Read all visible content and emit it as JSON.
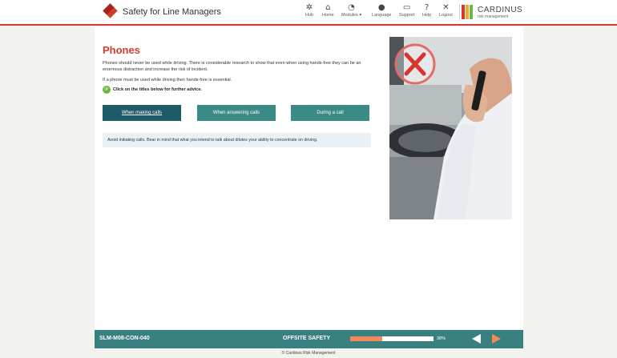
{
  "app": {
    "title": "Safety for Line Managers"
  },
  "nav": [
    {
      "label": "Hub",
      "icon": "hub-icon"
    },
    {
      "label": "Home",
      "icon": "home-icon"
    },
    {
      "label": "Modules ▾",
      "icon": "dashboard-icon"
    },
    {
      "label": "Language",
      "icon": "globe-icon"
    },
    {
      "label": "Support",
      "icon": "chat-icon"
    },
    {
      "label": "Help",
      "icon": "help-icon"
    },
    {
      "label": "Logout",
      "icon": "close-icon"
    }
  ],
  "brand": {
    "name": "CARDINUS",
    "sub": "risk management",
    "colors": [
      "#d33b2c",
      "#f0a830",
      "#6fb83f"
    ]
  },
  "page": {
    "heading": "Phones",
    "para1": "Phones should never be used while driving. There is considerable research to show that even when using hands-free they can be an enormous distraction and increase the risk of incident.",
    "para2": "If a phone must be used while driving then hands-free is essential.",
    "hint": "Click on the titles below for further advice.",
    "tabs": [
      "When making calls",
      "When answering calls",
      "During a call"
    ],
    "active_tab": 0,
    "panel_text": "Avoid initiating calls. Bear in mind that what you intend to talk about dilutes your ability to concentrate on driving."
  },
  "footer": {
    "code": "SLM-M08-CON-040",
    "section": "OFFSITE SAFETY",
    "progress_percent": 38,
    "progress_label": "38%",
    "copyright": "© Cardinus Risk Management"
  },
  "colors": {
    "accent": "#d33b2c",
    "teal": "#3a8080",
    "tab_active": "#1c5a68",
    "tab_inactive": "#3a8a85",
    "progress": "#f08a5d"
  }
}
